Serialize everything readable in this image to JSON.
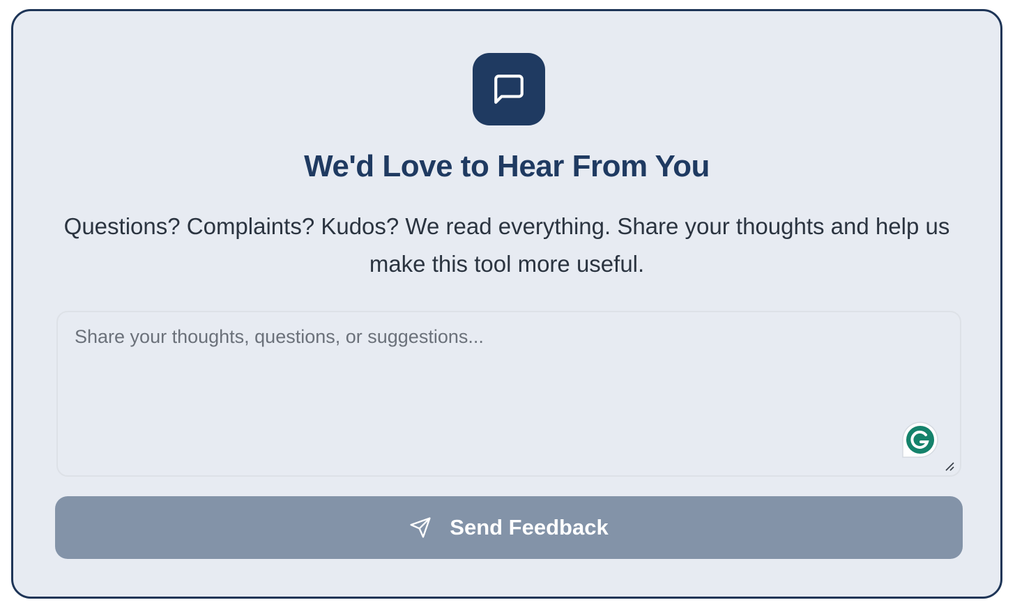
{
  "header": {
    "icon": "message-square-icon",
    "title": "We'd Love to Hear From You",
    "subtitle": "Questions? Complaints? Kudos? We read everything. Share your thoughts and help us make this tool more useful."
  },
  "feedback": {
    "placeholder": "Share your thoughts, questions, or suggestions...",
    "value": "",
    "extension_icon": "grammarly-icon"
  },
  "submit": {
    "label": "Send Feedback",
    "icon": "send-icon",
    "state": "disabled"
  },
  "colors": {
    "accent": "#1f3a61",
    "card_background": "#e7ebf2",
    "button_disabled": "#8393a8",
    "grammarly": "#15826b"
  }
}
